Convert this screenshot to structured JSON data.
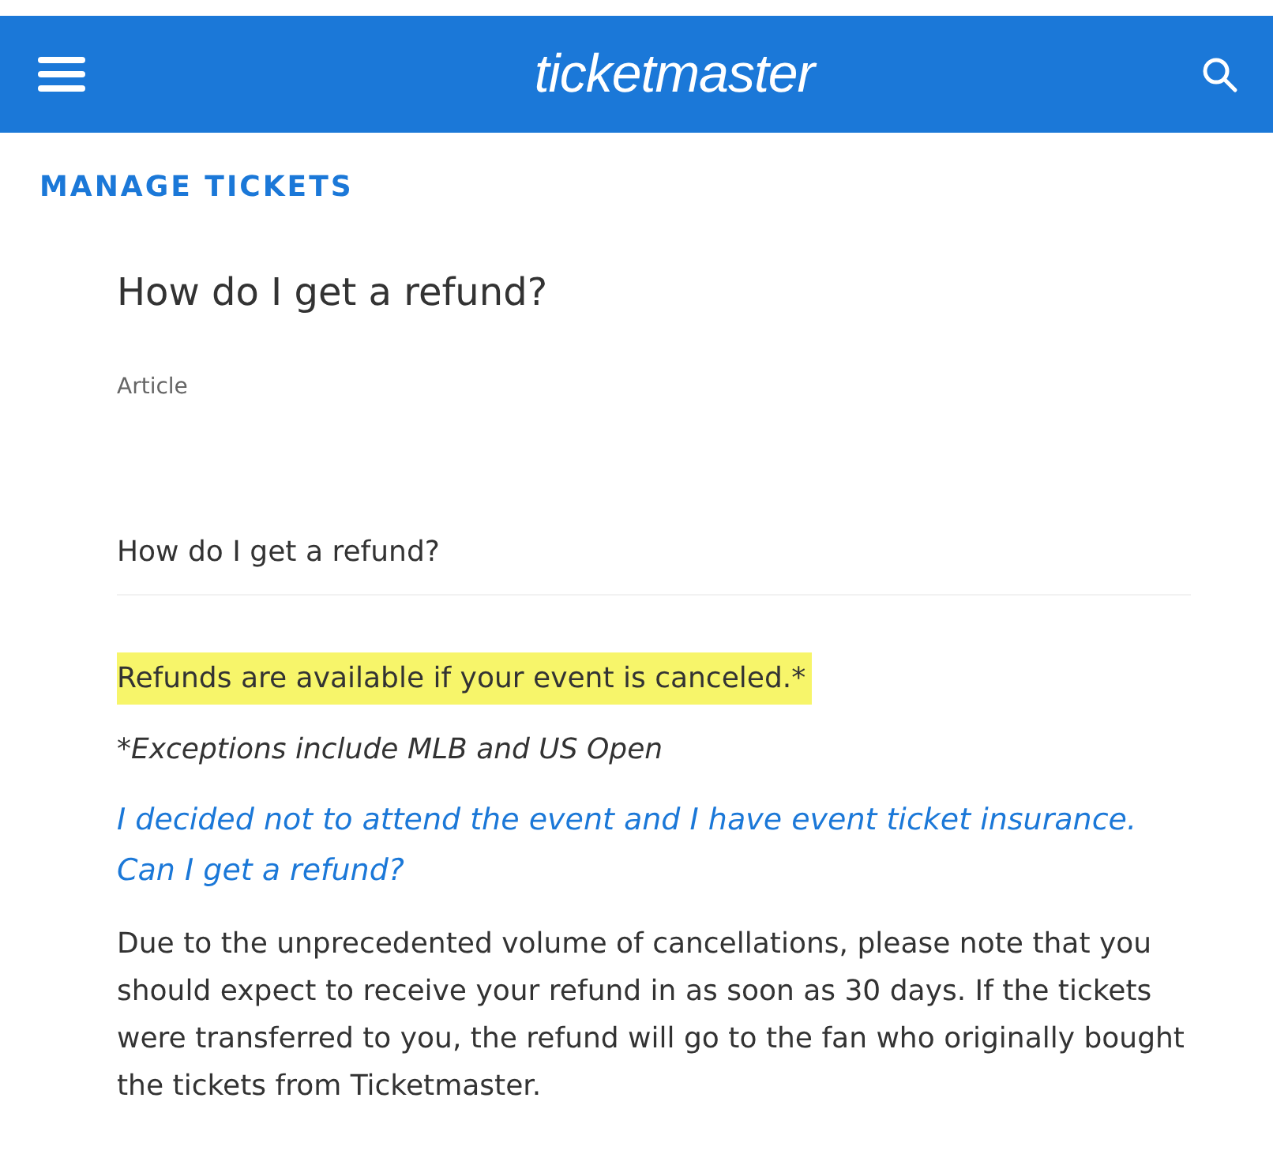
{
  "header": {
    "logo": "ticketmaster"
  },
  "section": "MANAGE TICKETS",
  "article": {
    "title": "How do I get a refund?",
    "type_label": "Article",
    "subheading": "How do I get a refund?",
    "statement": {
      "text": "Refunds are available if your event is canceled.*",
      "highlighted": true
    },
    "footnote": "*Exceptions include MLB and US Open",
    "question_link": "I decided not to attend the event and I have event ticket insurance. Can I get a refund?",
    "answer": "Due to the unprecedented volume of cancellations, please note that you should expect to receive your refund in as soon as 30 days.   If the tickets were transferred to you, the refund will go to the fan who originally bought the tickets from Ticketmaster."
  }
}
